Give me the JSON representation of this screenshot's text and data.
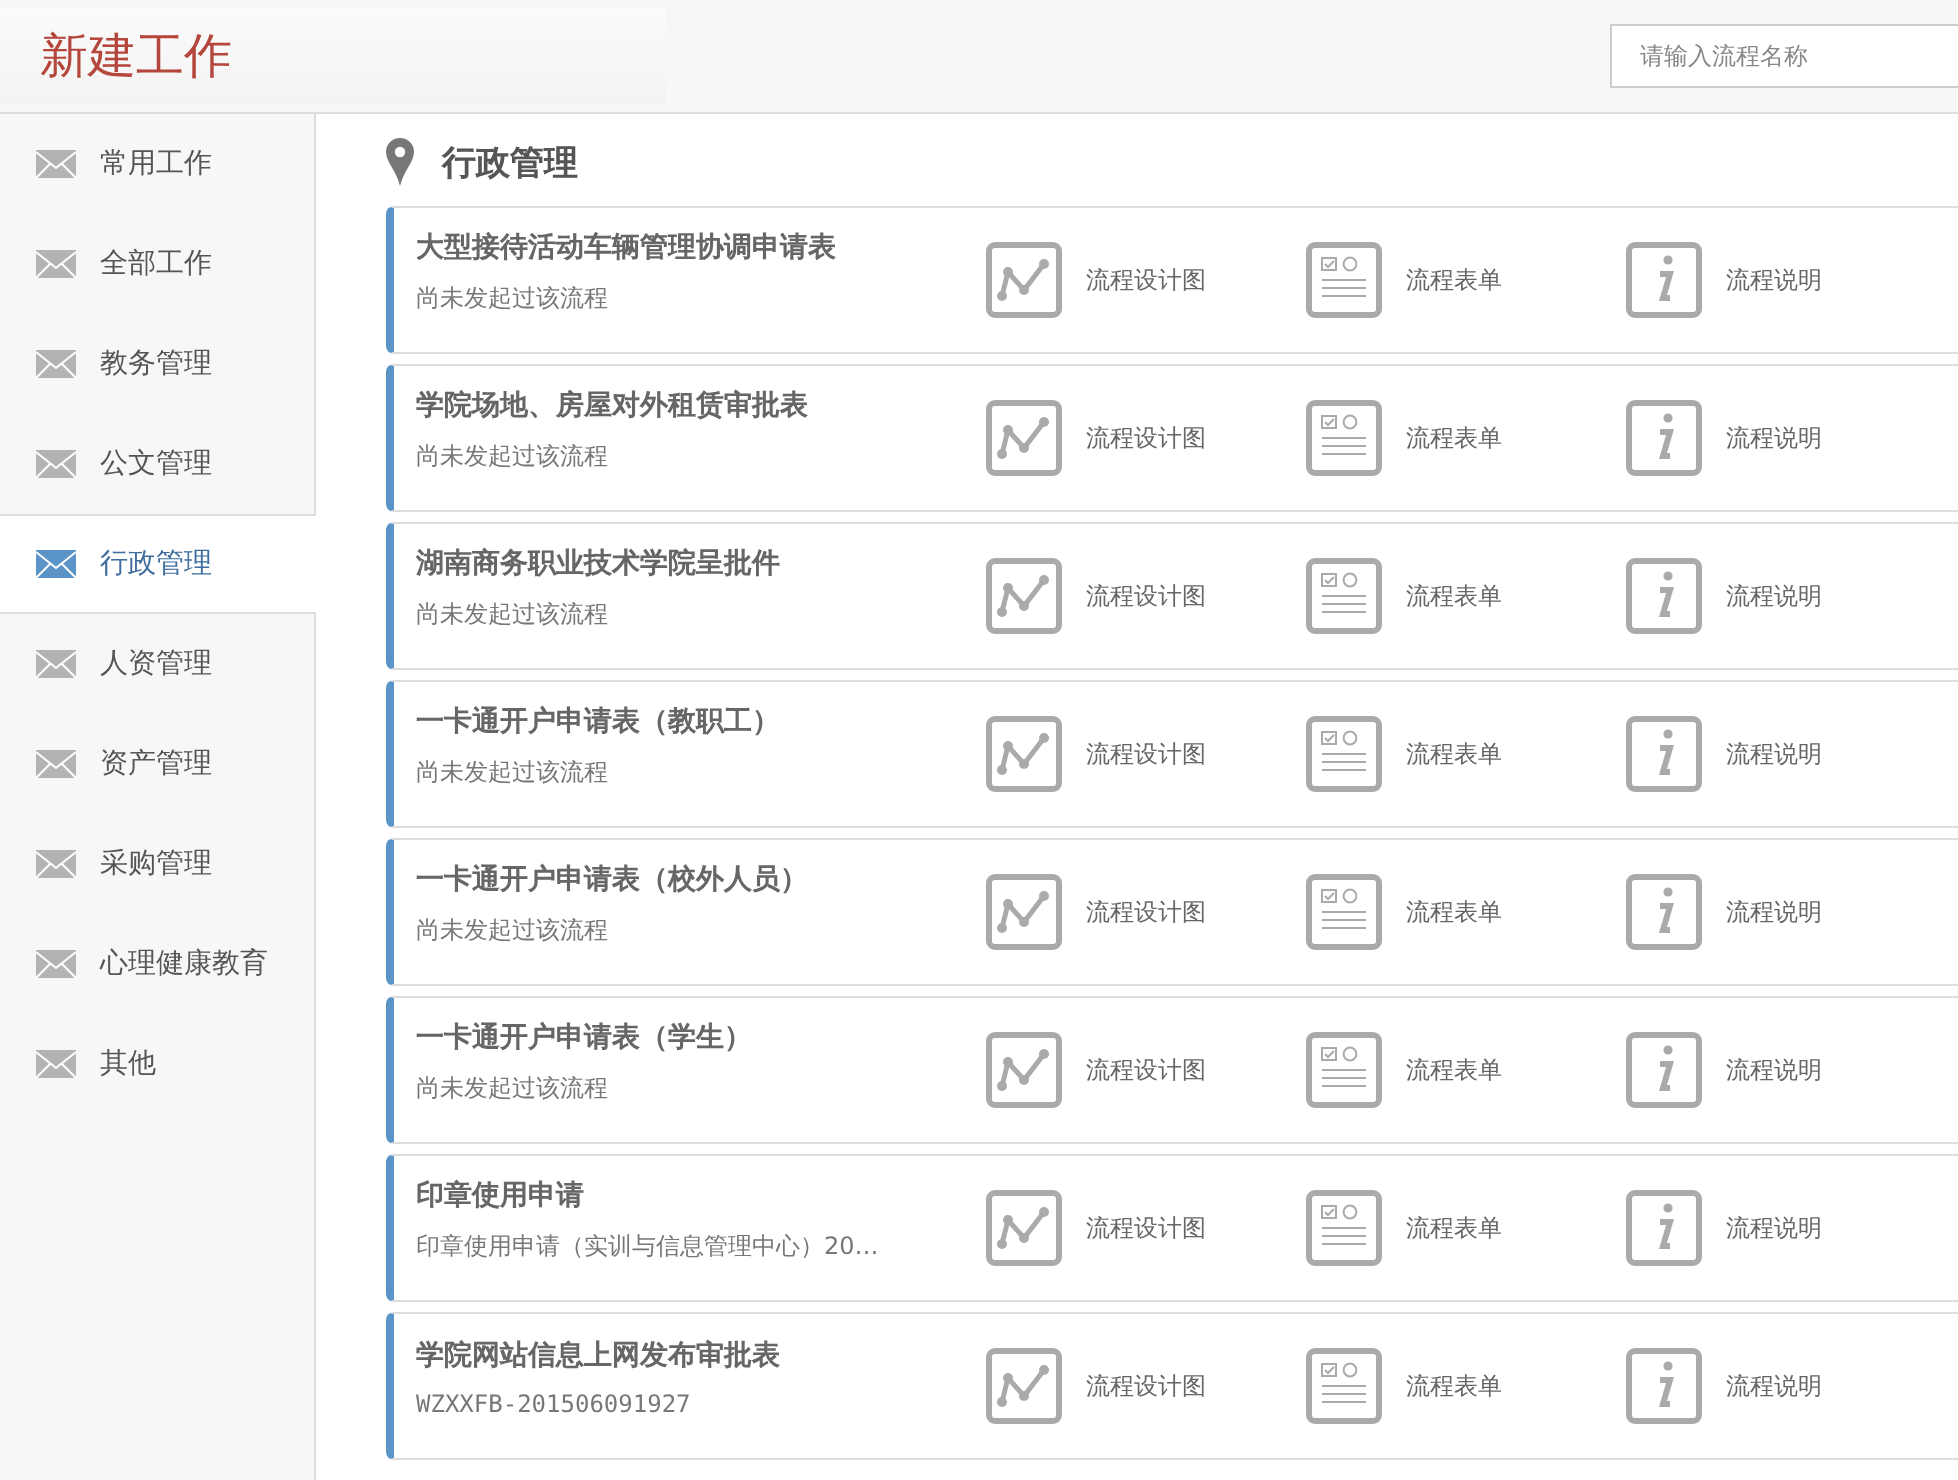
{
  "header": {
    "title": "新建工作"
  },
  "search": {
    "placeholder": "请输入流程名称"
  },
  "sidebar": {
    "items": [
      {
        "label": "常用工作",
        "selected": false
      },
      {
        "label": "全部工作",
        "selected": false
      },
      {
        "label": "教务管理",
        "selected": false
      },
      {
        "label": "公文管理",
        "selected": false
      },
      {
        "label": "行政管理",
        "selected": true
      },
      {
        "label": "人资管理",
        "selected": false
      },
      {
        "label": "资产管理",
        "selected": false
      },
      {
        "label": "采购管理",
        "selected": false
      },
      {
        "label": "心理健康教育",
        "selected": false
      },
      {
        "label": "其他",
        "selected": false
      }
    ]
  },
  "section": {
    "title": "行政管理"
  },
  "flows": [
    {
      "title": "大型接待活动车辆管理协调申请表",
      "subtitle": "尚未发起过该流程",
      "actions": [
        {
          "kind": "design",
          "label": "流程设计图"
        },
        {
          "kind": "form",
          "label": "流程表单"
        },
        {
          "kind": "info",
          "label": "流程说明"
        }
      ]
    },
    {
      "title": "学院场地、房屋对外租赁审批表",
      "subtitle": "尚未发起过该流程",
      "actions": [
        {
          "kind": "design",
          "label": "流程设计图"
        },
        {
          "kind": "form",
          "label": "流程表单"
        },
        {
          "kind": "info",
          "label": "流程说明"
        }
      ]
    },
    {
      "title": "湖南商务职业技术学院呈批件",
      "subtitle": "尚未发起过该流程",
      "actions": [
        {
          "kind": "design",
          "label": "流程设计图"
        },
        {
          "kind": "form",
          "label": "流程表单"
        },
        {
          "kind": "info",
          "label": "流程说明"
        }
      ]
    },
    {
      "title": "一卡通开户申请表（教职工）",
      "subtitle": "尚未发起过该流程",
      "actions": [
        {
          "kind": "design",
          "label": "流程设计图"
        },
        {
          "kind": "form",
          "label": "流程表单"
        },
        {
          "kind": "info",
          "label": "流程说明"
        }
      ]
    },
    {
      "title": "一卡通开户申请表（校外人员）",
      "subtitle": "尚未发起过该流程",
      "actions": [
        {
          "kind": "design",
          "label": "流程设计图"
        },
        {
          "kind": "form",
          "label": "流程表单"
        },
        {
          "kind": "info",
          "label": "流程说明"
        }
      ]
    },
    {
      "title": "一卡通开户申请表（学生）",
      "subtitle": "尚未发起过该流程",
      "actions": [
        {
          "kind": "design",
          "label": "流程设计图"
        },
        {
          "kind": "form",
          "label": "流程表单"
        },
        {
          "kind": "info",
          "label": "流程说明"
        }
      ]
    },
    {
      "title": "印章使用申请",
      "subtitle": "印章使用申请（实训与信息管理中心）20…",
      "actions": [
        {
          "kind": "design",
          "label": "流程设计图"
        },
        {
          "kind": "form",
          "label": "流程表单"
        },
        {
          "kind": "info",
          "label": "流程说明"
        }
      ]
    },
    {
      "title": "学院网站信息上网发布审批表",
      "subtitle": "WZXXFB-201506091927",
      "actions": [
        {
          "kind": "design",
          "label": "流程设计图"
        },
        {
          "kind": "form",
          "label": "流程表单"
        },
        {
          "kind": "info",
          "label": "流程说明"
        }
      ]
    }
  ]
}
